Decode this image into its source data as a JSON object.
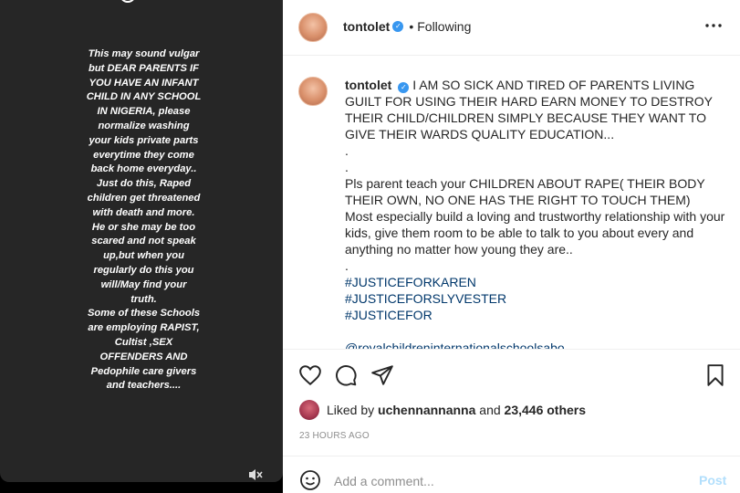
{
  "story": {
    "text": "This may sound vulgar\nbut DEAR PARENTS IF\nYOU HAVE AN INFANT\nCHILD IN ANY SCHOOL\nIN NIGERIA, please\nnormalize washing\nyour kids private parts\neverytime they come\nback home everyday..\nJust do this, Raped\nchildren get threatened\nwith death and more.\nHe or she may be too\nscared and not speak\nup,but when you\nregularly do this you\nwill/May find your\ntruth.\nSome of these Schools\nare employing RAPIST,\nCultist ,SEX\nOFFENDERS AND\nPedophile care givers\nand teachers...."
  },
  "header": {
    "username": "tontolet",
    "dot": "•",
    "follow_status": "Following"
  },
  "caption": {
    "username": "tontolet",
    "lines": [
      "I AM SO SICK AND TIRED OF PARENTS LIVING GUILT FOR USING THEIR HARD EARN MONEY TO DESTROY THEIR CHILD/CHILDREN SIMPLY BECAUSE THEY WANT TO GIVE THEIR WARDS QUALITY EDUCATION...",
      ".",
      ".",
      "Pls parent teach your CHILDREN ABOUT RAPE( THEIR BODY THEIR OWN, NO ONE HAS THE RIGHT TO TOUCH THEM)",
      "Most especially build a loving and trustworthy relationship with your kids, give them room to be able to talk to you about every and anything no matter how young they are..",
      "."
    ],
    "hashtags": [
      "#JUSTICEFORKAREN",
      "#JUSTICEFORSLYVESTER",
      "#JUSTICEFOR"
    ],
    "mention": "@royalchildreninternationalschoolsabo"
  },
  "likes": {
    "prefix": "Liked by",
    "liker": "uchennannanna",
    "and": "and",
    "others": "23,446 others"
  },
  "timestamp": "23 HOURS AGO",
  "comment": {
    "placeholder": "Add a comment...",
    "post_label": "Post"
  },
  "colors": {
    "link": "#00376b",
    "verified": "#3897f0",
    "post_disabled": "#b2dffc"
  }
}
